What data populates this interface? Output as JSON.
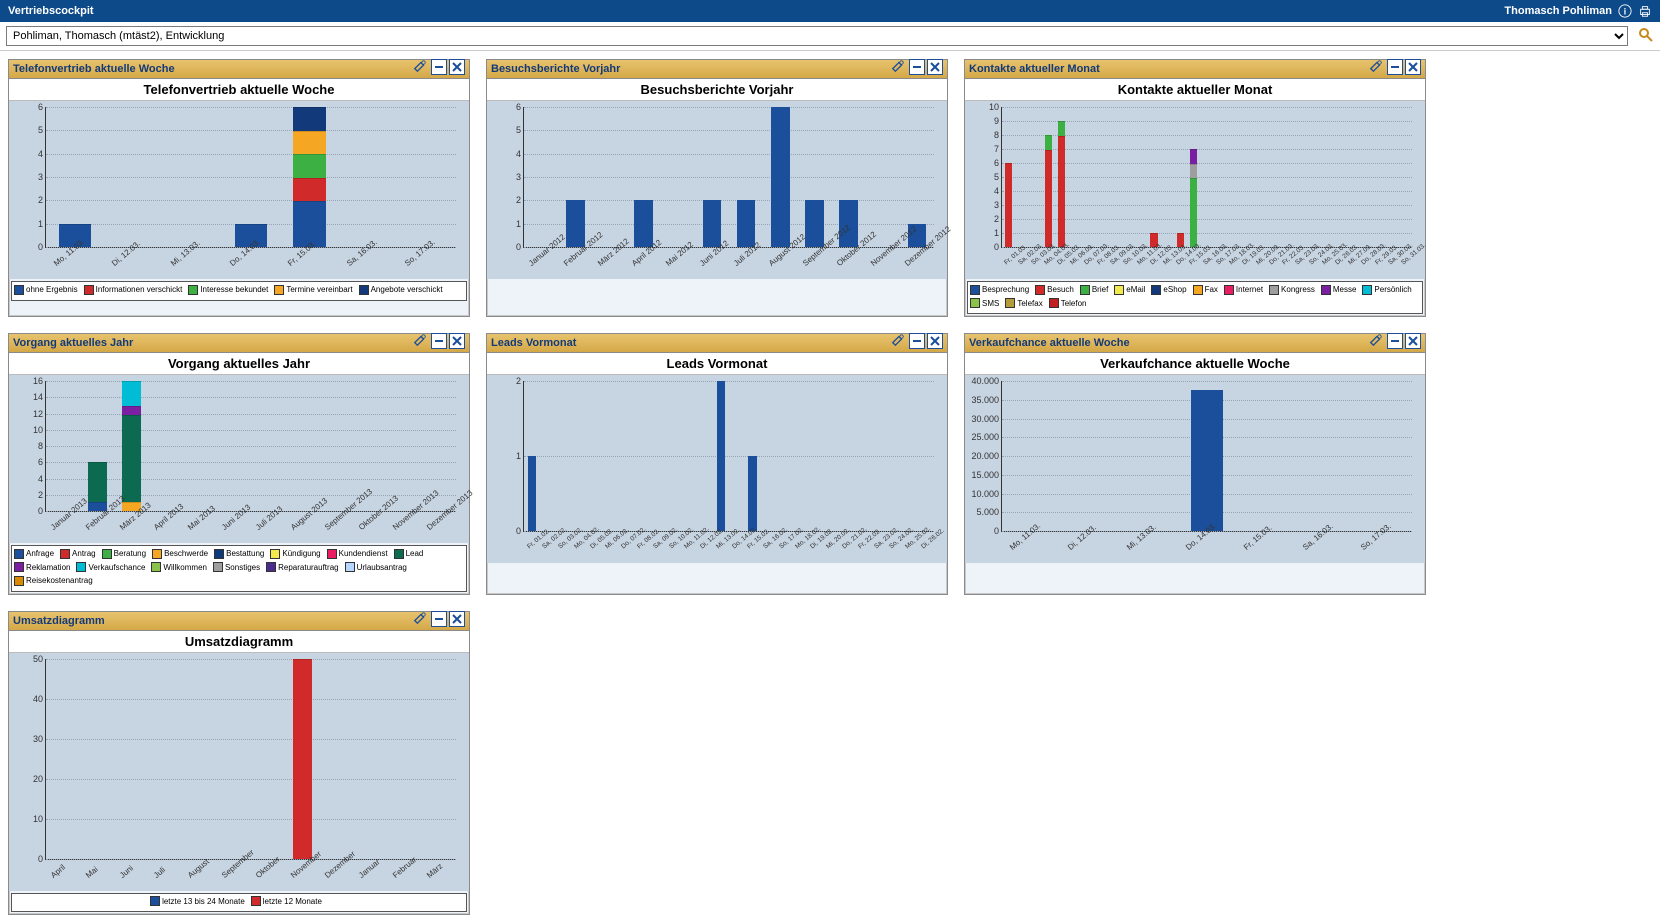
{
  "app": {
    "title": "Vertriebscockpit",
    "user": "Thomasch Pohliman",
    "search_value": "Pohliman, Thomasch (mtäst2), Entwicklung"
  },
  "panel1": {
    "header": "Telefonvertrieb aktuelle Woche",
    "title": "Telefonvertrieb aktuelle Woche"
  },
  "panel2": {
    "header": "Besuchsberichte Vorjahr",
    "title": "Besuchsberichte Vorjahr"
  },
  "panel3": {
    "header": "Kontakte aktueller Monat",
    "title": "Kontakte aktueller Monat"
  },
  "panel4": {
    "header": "Vorgang aktuelles Jahr",
    "title": "Vorgang aktuelles Jahr"
  },
  "panel5": {
    "header": "Leads Vormonat",
    "title": "Leads Vormonat"
  },
  "panel6": {
    "header": "Verkaufchance aktuelle Woche",
    "title": "Verkaufchance aktuelle Woche"
  },
  "panel7": {
    "header": "Umsatzdiagramm",
    "title": "Umsatzdiagramm"
  },
  "chart_data": [
    {
      "id": "p1",
      "type": "bar",
      "stacked": true,
      "title": "Telefonvertrieb aktuelle Woche",
      "categories": [
        "Mo, 11.03.",
        "Di, 12.03.",
        "Mi, 13.03.",
        "Do, 14.03.",
        "Fr, 15.03.",
        "Sa, 16.03.",
        "So, 17.03."
      ],
      "series": [
        {
          "name": "ohne Ergebnis",
          "color": "#1b4f9c",
          "values": [
            1,
            0,
            0,
            1,
            2,
            0,
            0
          ]
        },
        {
          "name": "Informationen verschickt",
          "color": "#d02a2a",
          "values": [
            0,
            0,
            0,
            0,
            1,
            0,
            0
          ]
        },
        {
          "name": "Interesse bekundet",
          "color": "#3cb043",
          "values": [
            0,
            0,
            0,
            0,
            1,
            0,
            0
          ]
        },
        {
          "name": "Termine vereinbart",
          "color": "#f5a623",
          "values": [
            0,
            0,
            0,
            0,
            1,
            0,
            0
          ]
        },
        {
          "name": "Angebote verschickt",
          "color": "#123a7a",
          "values": [
            0,
            0,
            0,
            0,
            1,
            0,
            0
          ]
        }
      ],
      "ylim": [
        0,
        6
      ],
      "ystep": 1,
      "legend": [
        "ohne Ergebnis",
        "Informationen verschickt",
        "Interesse bekundet",
        "Termine vereinbart",
        "Angebote verschickt"
      ]
    },
    {
      "id": "p2",
      "type": "bar",
      "title": "Besuchsberichte Vorjahr",
      "categories": [
        "Januar 2012",
        "Februar 2012",
        "März 2012",
        "April 2012",
        "Mai 2012",
        "Juni 2012",
        "Juli 2012",
        "August 2012",
        "September 2012",
        "Oktober 2012",
        "November 2012",
        "Dezember 2012"
      ],
      "values": [
        0,
        2,
        0,
        2,
        0,
        2,
        2,
        6,
        2,
        2,
        0,
        1
      ],
      "color": "#1b4f9c",
      "ylim": [
        0,
        6
      ],
      "ystep": 1
    },
    {
      "id": "p3",
      "type": "bar",
      "stacked": true,
      "title": "Kontakte aktueller Monat",
      "categories": [
        "Fr, 01.03.",
        "Sa, 02.03.",
        "So, 03.03.",
        "Mo, 04.03.",
        "Di, 05.03.",
        "Mi, 06.03.",
        "Do, 07.03.",
        "Fr, 08.03.",
        "Sa, 09.03.",
        "So, 10.03.",
        "Mo, 11.03.",
        "Di, 12.03.",
        "Mi, 13.03.",
        "Do, 14.03.",
        "Fr, 15.03.",
        "Sa, 16.03.",
        "So, 17.03.",
        "Mo, 18.03.",
        "Di, 19.03.",
        "Mi, 20.03.",
        "Do, 21.03.",
        "Fr, 22.03.",
        "Sa, 23.03.",
        "So, 24.03.",
        "Mo, 25.03.",
        "Di, 26.03.",
        "Mi, 27.03.",
        "Do, 28.03.",
        "Fr, 29.03.",
        "Sa, 30.03.",
        "So, 31.03."
      ],
      "series": [
        {
          "name": "Besprechung",
          "color": "#1b4f9c",
          "values": [
            0,
            0,
            0,
            0,
            0,
            0,
            0,
            0,
            0,
            0,
            0,
            0,
            0,
            0,
            0,
            0,
            0,
            0,
            0,
            0,
            0,
            0,
            0,
            0,
            0,
            0,
            0,
            0,
            0,
            0,
            0
          ]
        },
        {
          "name": "Besuch",
          "color": "#d02a2a",
          "values": [
            6,
            0,
            0,
            7,
            8,
            0,
            0,
            0,
            0,
            0,
            0,
            1,
            0,
            1,
            0,
            0,
            0,
            0,
            0,
            0,
            0,
            0,
            0,
            0,
            0,
            0,
            0,
            0,
            0,
            0,
            0
          ]
        },
        {
          "name": "Brief",
          "color": "#3cb043",
          "values": [
            0,
            0,
            0,
            1,
            1,
            0,
            0,
            0,
            0,
            0,
            0,
            0,
            0,
            0,
            5,
            0,
            0,
            0,
            0,
            0,
            0,
            0,
            0,
            0,
            0,
            0,
            0,
            0,
            0,
            0,
            0
          ]
        },
        {
          "name": "eMail",
          "color": "#f2e94e",
          "values": [
            0,
            0,
            0,
            0,
            0,
            0,
            0,
            0,
            0,
            0,
            0,
            0,
            0,
            0,
            0,
            0,
            0,
            0,
            0,
            0,
            0,
            0,
            0,
            0,
            0,
            0,
            0,
            0,
            0,
            0,
            0
          ]
        },
        {
          "name": "eShop",
          "color": "#123a7a",
          "values": [
            0,
            0,
            0,
            0,
            0,
            0,
            0,
            0,
            0,
            0,
            0,
            0,
            0,
            0,
            0,
            0,
            0,
            0,
            0,
            0,
            0,
            0,
            0,
            0,
            0,
            0,
            0,
            0,
            0,
            0,
            0
          ]
        },
        {
          "name": "Fax",
          "color": "#f5a623",
          "values": [
            0,
            0,
            0,
            0,
            0,
            0,
            0,
            0,
            0,
            0,
            0,
            0,
            0,
            0,
            0,
            0,
            0,
            0,
            0,
            0,
            0,
            0,
            0,
            0,
            0,
            0,
            0,
            0,
            0,
            0,
            0
          ]
        },
        {
          "name": "Internet",
          "color": "#e91e63",
          "values": [
            0,
            0,
            0,
            0,
            0,
            0,
            0,
            0,
            0,
            0,
            0,
            0,
            0,
            0,
            0,
            0,
            0,
            0,
            0,
            0,
            0,
            0,
            0,
            0,
            0,
            0,
            0,
            0,
            0,
            0,
            0
          ]
        },
        {
          "name": "Kongress",
          "color": "#9e9e9e",
          "values": [
            0,
            0,
            0,
            0,
            0,
            0,
            0,
            0,
            0,
            0,
            0,
            0,
            0,
            0,
            1,
            0,
            0,
            0,
            0,
            0,
            0,
            0,
            0,
            0,
            0,
            0,
            0,
            0,
            0,
            0,
            0
          ]
        },
        {
          "name": "Messe",
          "color": "#7b1fa2",
          "values": [
            0,
            0,
            0,
            0,
            0,
            0,
            0,
            0,
            0,
            0,
            0,
            0,
            0,
            0,
            1,
            0,
            0,
            0,
            0,
            0,
            0,
            0,
            0,
            0,
            0,
            0,
            0,
            0,
            0,
            0,
            0
          ]
        },
        {
          "name": "Persönlich",
          "color": "#00bcd4",
          "values": [
            0,
            0,
            0,
            0,
            0,
            0,
            0,
            0,
            0,
            0,
            0,
            0,
            0,
            0,
            0,
            0,
            0,
            0,
            0,
            0,
            0,
            0,
            0,
            0,
            0,
            0,
            0,
            0,
            0,
            0,
            0
          ]
        },
        {
          "name": "SMS",
          "color": "#8bc34a",
          "values": [
            0,
            0,
            0,
            0,
            0,
            0,
            0,
            0,
            0,
            0,
            0,
            0,
            0,
            0,
            0,
            0,
            0,
            0,
            0,
            0,
            0,
            0,
            0,
            0,
            0,
            0,
            0,
            0,
            0,
            0,
            0
          ]
        },
        {
          "name": "Telefax",
          "color": "#b69b3a",
          "values": [
            0,
            0,
            0,
            0,
            0,
            0,
            0,
            0,
            0,
            0,
            0,
            0,
            0,
            0,
            0,
            0,
            0,
            0,
            0,
            0,
            0,
            0,
            0,
            0,
            0,
            0,
            0,
            0,
            0,
            0,
            0
          ]
        },
        {
          "name": "Telefon",
          "color": "#c22020",
          "values": [
            0,
            0,
            0,
            0,
            0,
            0,
            0,
            0,
            0,
            0,
            0,
            0,
            0,
            0,
            0,
            0,
            0,
            0,
            0,
            0,
            0,
            0,
            0,
            0,
            0,
            0,
            0,
            0,
            0,
            0,
            0
          ]
        }
      ],
      "ylim": [
        0,
        10
      ],
      "ystep": 1,
      "legend": [
        "Besprechung",
        "Besuch",
        "Brief",
        "eMail",
        "eShop",
        "Fax",
        "Internet",
        "Kongress",
        "Messe",
        "Persönlich",
        "SMS",
        "Telefax",
        "Telefon"
      ]
    },
    {
      "id": "p4",
      "type": "bar",
      "stacked": true,
      "title": "Vorgang aktuelles Jahr",
      "categories": [
        "Januar 2013",
        "Februar 2013",
        "März 2013",
        "April 2013",
        "Mai 2013",
        "Juni 2013",
        "Juli 2013",
        "August 2013",
        "September 2013",
        "Oktober 2013",
        "November 2013",
        "Dezember 2013"
      ],
      "series": [
        {
          "name": "Anfrage",
          "color": "#1b4f9c",
          "values": [
            0,
            1,
            0,
            0,
            0,
            0,
            0,
            0,
            0,
            0,
            0,
            0
          ]
        },
        {
          "name": "Antrag",
          "color": "#d02a2a",
          "values": [
            0,
            0,
            0,
            0,
            0,
            0,
            0,
            0,
            0,
            0,
            0,
            0
          ]
        },
        {
          "name": "Beratung",
          "color": "#3cb043",
          "values": [
            0,
            0,
            0,
            0,
            0,
            0,
            0,
            0,
            0,
            0,
            0,
            0
          ]
        },
        {
          "name": "Beschwerde",
          "color": "#f5a623",
          "values": [
            0,
            0,
            1,
            0,
            0,
            0,
            0,
            0,
            0,
            0,
            0,
            0
          ]
        },
        {
          "name": "Bestattung",
          "color": "#0b3a7a",
          "values": [
            0,
            0,
            0,
            0,
            0,
            0,
            0,
            0,
            0,
            0,
            0,
            0
          ]
        },
        {
          "name": "Kündigung",
          "color": "#f2e94e",
          "values": [
            0,
            0,
            0,
            0,
            0,
            0,
            0,
            0,
            0,
            0,
            0,
            0
          ]
        },
        {
          "name": "Kundendienst",
          "color": "#e91e63",
          "values": [
            0,
            0,
            0,
            0,
            0,
            0,
            0,
            0,
            0,
            0,
            0,
            0
          ]
        },
        {
          "name": "Lead",
          "color": "#0b6a4f",
          "values": [
            0,
            5,
            11,
            0,
            0,
            0,
            0,
            0,
            0,
            0,
            0,
            0
          ]
        },
        {
          "name": "Reklamation",
          "color": "#7b1fa2",
          "values": [
            0,
            0,
            1,
            0,
            0,
            0,
            0,
            0,
            0,
            0,
            0,
            0
          ]
        },
        {
          "name": "Verkaufschance",
          "color": "#00bcd4",
          "values": [
            0,
            0,
            3,
            0,
            0,
            0,
            0,
            0,
            0,
            0,
            0,
            0
          ]
        },
        {
          "name": "Willkommen",
          "color": "#8bc34a",
          "values": [
            0,
            0,
            0,
            0,
            0,
            0,
            0,
            0,
            0,
            0,
            0,
            0
          ]
        },
        {
          "name": "Sonstiges",
          "color": "#9e9e9e",
          "values": [
            0,
            0,
            0,
            0,
            0,
            0,
            0,
            0,
            0,
            0,
            0,
            0
          ]
        },
        {
          "name": "Reparaturauftrag",
          "color": "#4a2c8f",
          "values": [
            0,
            0,
            0,
            0,
            0,
            0,
            0,
            0,
            0,
            0,
            0,
            0
          ]
        },
        {
          "name": "Urlaubsantrag",
          "color": "#b6d7ff",
          "values": [
            0,
            0,
            0,
            0,
            0,
            0,
            0,
            0,
            0,
            0,
            0,
            0
          ]
        },
        {
          "name": "Reisekostenantrag",
          "color": "#d88a00",
          "values": [
            0,
            0,
            0,
            0,
            0,
            0,
            0,
            0,
            0,
            0,
            0,
            0
          ]
        }
      ],
      "ylim": [
        0,
        16
      ],
      "ystep": 2,
      "legend": [
        "Anfrage",
        "Antrag",
        "Beratung",
        "Beschwerde",
        "Bestattung",
        "Kündigung",
        "Kundendienst",
        "Lead",
        "Reklamation",
        "Verkaufschance",
        "Willkommen",
        "Sonstiges",
        "Reparaturauftrag",
        "Urlaubsantrag",
        "Reisekostenantrag"
      ]
    },
    {
      "id": "p5",
      "type": "bar",
      "title": "Leads Vormonat",
      "categories": [
        "Fr, 01.02.",
        "Sa, 02.02.",
        "So, 03.02.",
        "Mo, 04.02.",
        "Di, 05.02.",
        "Mi, 06.02.",
        "Do, 07.02.",
        "Fr, 08.02.",
        "Sa, 09.02.",
        "So, 10.02.",
        "Mo, 11.02.",
        "Di, 12.02.",
        "Mi, 13.02.",
        "Do, 14.02.",
        "Fr, 15.02.",
        "Sa, 16.02.",
        "So, 17.02.",
        "Mo, 18.02.",
        "Di, 19.02.",
        "Mi, 20.02.",
        "Do, 21.02.",
        "Fr, 22.02.",
        "Sa, 23.02.",
        "So, 24.02.",
        "Mo, 25.02.",
        "Di, 26.02."
      ],
      "values": [
        1,
        0,
        0,
        0,
        0,
        0,
        0,
        0,
        0,
        0,
        0,
        0,
        2,
        0,
        1,
        0,
        0,
        0,
        0,
        0,
        0,
        0,
        0,
        0,
        0,
        0
      ],
      "color": "#1b4f9c",
      "ylim": [
        0,
        2
      ],
      "ystep": 1
    },
    {
      "id": "p6",
      "type": "bar",
      "title": "Verkaufchance aktuelle Woche",
      "categories": [
        "Mo, 11.03.",
        "Di, 12.03.",
        "Mi, 13.03.",
        "Do, 14.03.",
        "Fr, 15.03.",
        "Sa, 16.03.",
        "So, 17.03."
      ],
      "values": [
        0,
        0,
        0,
        37500,
        0,
        0,
        0
      ],
      "color": "#1b4f9c",
      "ylim": [
        0,
        40000
      ],
      "ystep": 5000,
      "yformat": "dot"
    },
    {
      "id": "p7",
      "type": "bar",
      "stacked": true,
      "title": "Umsatzdiagramm",
      "categories": [
        "April",
        "Mai",
        "Juni",
        "Juli",
        "August",
        "September",
        "Oktober",
        "November",
        "Dezember",
        "Januar",
        "Februar",
        "März"
      ],
      "series": [
        {
          "name": "letzte 13 bis 24 Monate",
          "color": "#1b4f9c",
          "values": [
            0,
            0,
            0,
            0,
            0,
            0,
            0,
            0,
            0,
            0,
            0,
            0
          ]
        },
        {
          "name": "letzte 12 Monate",
          "color": "#d02a2a",
          "values": [
            0,
            0,
            0,
            0,
            0,
            0,
            0,
            50,
            0,
            0,
            0,
            0
          ]
        }
      ],
      "ylim": [
        0,
        50
      ],
      "ystep": 10,
      "legend": [
        "letzte 13 bis 24 Monate",
        "letzte 12 Monate"
      ]
    }
  ]
}
